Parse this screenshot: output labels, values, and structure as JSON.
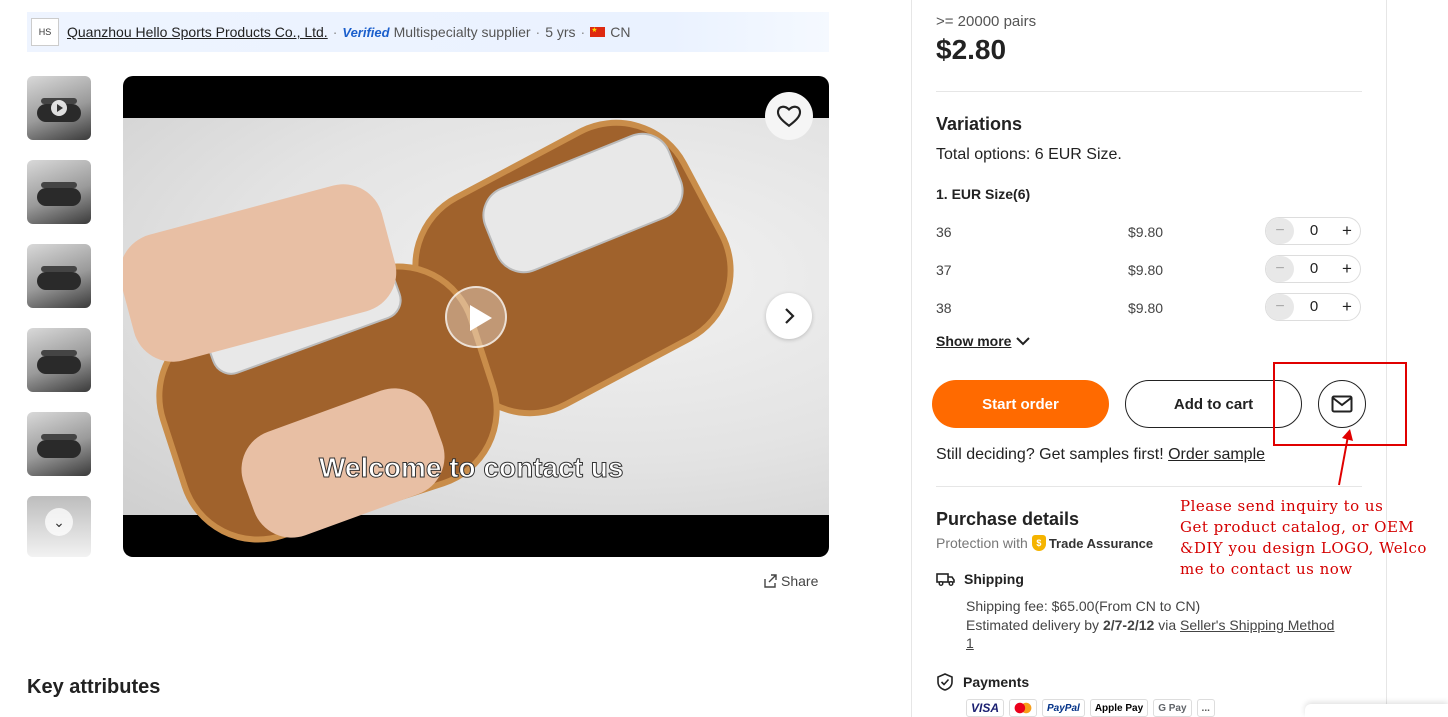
{
  "supplier": {
    "logo_text": "HS",
    "name": "Quanzhou Hello Sports Products Co., Ltd.",
    "verified": "Verified",
    "type": "Multispecialty supplier",
    "years": "5 yrs",
    "country": "CN"
  },
  "gallery": {
    "thumbnails": [
      {
        "icon": "play-icon"
      },
      {},
      {},
      {},
      {},
      {
        "icon": "chevron-down-icon"
      }
    ],
    "video_caption": "Welcome to contact us"
  },
  "share_label": "Share",
  "key_attributes_title": "Key attributes",
  "pricing": {
    "min_order": ">= 20000 pairs",
    "price": "$2.80"
  },
  "variations": {
    "title": "Variations",
    "total_label": "Total options:",
    "total_value": "6 EUR Size.",
    "group_title": "1. EUR Size(6)",
    "rows": [
      {
        "size": "36",
        "price": "$9.80",
        "qty": "0"
      },
      {
        "size": "37",
        "price": "$9.80",
        "qty": "0"
      },
      {
        "size": "38",
        "price": "$9.80",
        "qty": "0"
      }
    ],
    "show_more": "Show more"
  },
  "actions": {
    "start_order": "Start order",
    "add_to_cart": "Add to cart"
  },
  "samples": {
    "text": "Still deciding? Get samples first!",
    "link": "Order sample"
  },
  "annotation": {
    "lines": [
      "Please send inquiry to us",
      "Get product catalog, or OEM",
      "&DIY you design LOGO, Welco",
      "me to contact us now"
    ],
    "color": "#d40000"
  },
  "purchase": {
    "title": "Purchase details",
    "protection_label": "Protection with",
    "trade_assurance": "Trade Assurance",
    "shipping_title": "Shipping",
    "shipping_fee": "Shipping fee: $65.00(From CN to CN)",
    "delivery_prefix": "Estimated delivery by",
    "delivery_dates": "2/7-2/12",
    "delivery_via": "via",
    "delivery_method": "Seller's Shipping Method 1",
    "payments_title": "Payments",
    "payment_methods": [
      "VISA",
      "MC",
      "PayPal",
      "Apple Pay",
      "G Pay",
      "..."
    ]
  },
  "colors": {
    "accent": "#ff6a00",
    "annotation": "#e00000"
  }
}
